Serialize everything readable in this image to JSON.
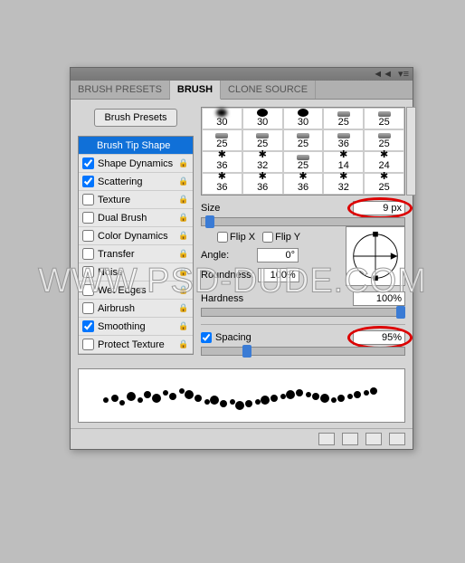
{
  "watermark": "WWW.PSD-DUDE.COM",
  "tabs": {
    "presets": "BRUSH PRESETS",
    "brush": "BRUSH",
    "clone": "CLONE SOURCE"
  },
  "button_presets": "Brush Presets",
  "options": [
    {
      "label": "Brush Tip Shape",
      "checkbox": false,
      "checked": false,
      "selected": true,
      "lock": false
    },
    {
      "label": "Shape Dynamics",
      "checkbox": true,
      "checked": true,
      "lock": true
    },
    {
      "label": "Scattering",
      "checkbox": true,
      "checked": true,
      "lock": true
    },
    {
      "label": "Texture",
      "checkbox": true,
      "checked": false,
      "lock": true
    },
    {
      "label": "Dual Brush",
      "checkbox": true,
      "checked": false,
      "lock": true
    },
    {
      "label": "Color Dynamics",
      "checkbox": true,
      "checked": false,
      "lock": true
    },
    {
      "label": "Transfer",
      "checkbox": true,
      "checked": false,
      "lock": true
    },
    {
      "label": "Noise",
      "checkbox": true,
      "checked": false,
      "lock": true
    },
    {
      "label": "Wet Edges",
      "checkbox": true,
      "checked": false,
      "lock": true
    },
    {
      "label": "Airbrush",
      "checkbox": true,
      "checked": false,
      "lock": true
    },
    {
      "label": "Smoothing",
      "checkbox": true,
      "checked": true,
      "lock": true
    },
    {
      "label": "Protect Texture",
      "checkbox": true,
      "checked": false,
      "lock": true
    }
  ],
  "preset_sizes": [
    "30",
    "30",
    "30",
    "25",
    "25",
    "25",
    "25",
    "25",
    "36",
    "25",
    "36",
    "32",
    "25",
    "14",
    "24",
    "36",
    "36",
    "36",
    "32",
    "25"
  ],
  "size_label": "Size",
  "size_value": "9 px",
  "flipx": "Flip X",
  "flipy": "Flip Y",
  "angle_label": "Angle:",
  "angle_value": "0°",
  "roundness_label": "Roundness:",
  "roundness_value": "100%",
  "hardness_label": "Hardness",
  "hardness_value": "100%",
  "spacing_label": "Spacing",
  "spacing_value": "95%"
}
